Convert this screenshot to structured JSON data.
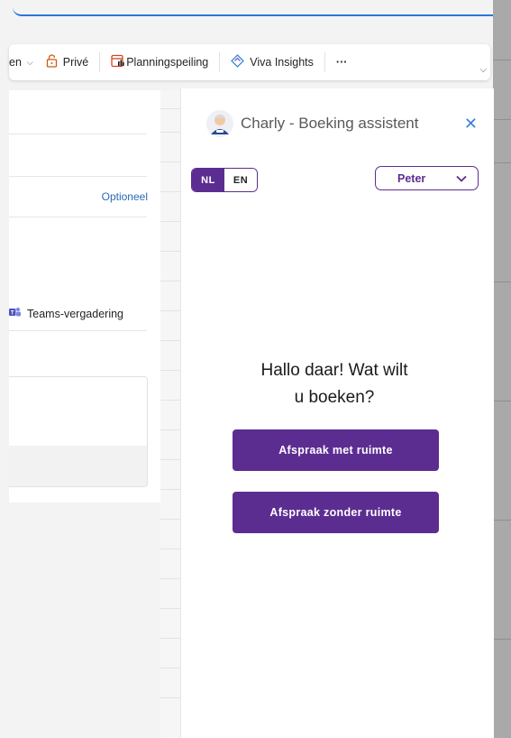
{
  "ribbon": {
    "truncated_item": "en",
    "private_label": "Privé",
    "planning_label": "Planningspeiling",
    "viva_label": "Viva Insights",
    "more_label": "···"
  },
  "form": {
    "optional_label": "Optioneel",
    "teams_label": "Teams-vergadering"
  },
  "panel": {
    "title": "Charly - Boeking assistent",
    "close_symbol": "✕",
    "lang_nl": "NL",
    "lang_en": "EN",
    "active_lang": "NL",
    "user_name": "Peter",
    "greeting_line1": "Hallo daar! Wat wilt",
    "greeting_line2": "u boeken?",
    "btn_with_room": "Afspraak met ruimte",
    "btn_without_room": "Afspraak zonder ruimte",
    "accent_color": "#5c2d91"
  }
}
